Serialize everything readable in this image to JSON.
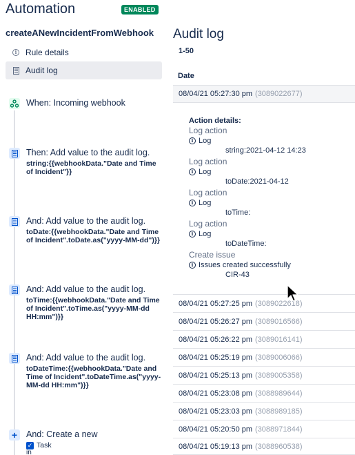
{
  "header": {
    "title": "Automation",
    "status_badge": "ENABLED"
  },
  "sidebar": {
    "rule_name": "createANewIncidentFromWebhook",
    "nav": [
      {
        "label": "Rule details",
        "icon": "info-icon"
      },
      {
        "label": "Audit log",
        "icon": "document-icon",
        "active": true
      }
    ],
    "components": [
      {
        "type": "trigger",
        "icon": "webhook-icon",
        "title": "When: Incoming webhook",
        "detail": ""
      },
      {
        "type": "action",
        "icon": "audit-log-icon",
        "title": "Then: Add value to the audit log.",
        "detail": "string:{{webhookData.\"Date and Time of Incident\"}}"
      },
      {
        "type": "action",
        "icon": "audit-log-icon",
        "title": "And: Add value to the audit log.",
        "detail": "toDate:{{webhookData.\"Date and Time of Incident\".toDate.as(\"yyyy-MM-dd\")}}"
      },
      {
        "type": "action",
        "icon": "audit-log-icon",
        "title": "And: Add value to the audit log.",
        "detail": "toTime:{{webhookData.\"Date and Time of Incident\".toTime.as(\"yyyy-MM-dd HH:mm\")}}"
      },
      {
        "type": "action",
        "icon": "audit-log-icon",
        "title": "And: Add value to the audit log.",
        "detail": "toDateTime:{{webhookData.\"Date and Time of Incident\".toDateTime.as(\"yyyy-MM-dd HH:mm\")}}"
      },
      {
        "type": "action",
        "icon": "plus-icon",
        "title": "And: Create a new",
        "detail": ""
      }
    ],
    "create_task": {
      "label": "Task",
      "suffix": "in"
    }
  },
  "audit": {
    "title": "Audit log",
    "range": "1-50",
    "column_header": "Date",
    "expanded_row": {
      "date": "08/04/21 05:27:30 pm",
      "id": "(3089022677)"
    },
    "details_header": "Action details:",
    "entries": [
      {
        "type": "Log action",
        "status": "Log",
        "message": "string:2021-04-12 14:23"
      },
      {
        "type": "Log action",
        "status": "Log",
        "message": "toDate:2021-04-12"
      },
      {
        "type": "Log action",
        "status": "Log",
        "message": "toTime:"
      },
      {
        "type": "Log action",
        "status": "Log",
        "message": "toDateTime:"
      },
      {
        "type": "Create issue",
        "status": "Issues created successfully",
        "message": "CIR-43"
      }
    ],
    "rows": [
      {
        "date": "08/04/21 05:27:25 pm",
        "id": "(3089022618)"
      },
      {
        "date": "08/04/21 05:26:27 pm",
        "id": "(3089016566)"
      },
      {
        "date": "08/04/21 05:26:22 pm",
        "id": "(3089016141)"
      },
      {
        "date": "08/04/21 05:25:19 pm",
        "id": "(3089006066)"
      },
      {
        "date": "08/04/21 05:25:13 pm",
        "id": "(3089005358)"
      },
      {
        "date": "08/04/21 05:23:08 pm",
        "id": "(3088989644)"
      },
      {
        "date": "08/04/21 05:23:03 pm",
        "id": "(3088989185)"
      },
      {
        "date": "08/04/21 05:20:50 pm",
        "id": "(3088971844)"
      },
      {
        "date": "08/04/21 05:19:13 pm",
        "id": "(3088960538)"
      }
    ]
  }
}
